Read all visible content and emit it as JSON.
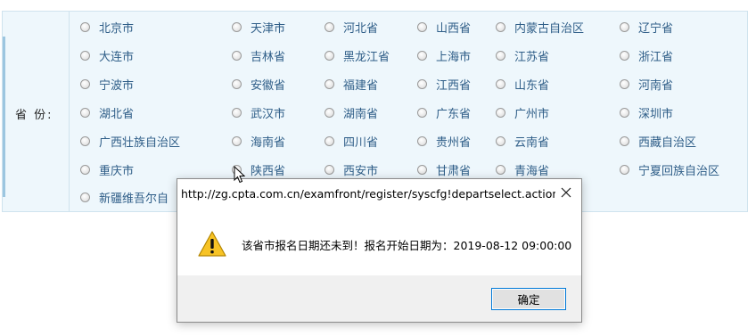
{
  "form": {
    "province_label": "省  份:",
    "options": [
      {
        "label": "北京市"
      },
      {
        "label": "天津市"
      },
      {
        "label": "河北省"
      },
      {
        "label": "山西省"
      },
      {
        "label": "内蒙古自治区"
      },
      {
        "label": "辽宁省"
      },
      {
        "label": "大连市"
      },
      {
        "label": "吉林省"
      },
      {
        "label": "黑龙江省"
      },
      {
        "label": "上海市"
      },
      {
        "label": "江苏省"
      },
      {
        "label": "浙江省"
      },
      {
        "label": "宁波市"
      },
      {
        "label": "安徽省"
      },
      {
        "label": "福建省"
      },
      {
        "label": "江西省"
      },
      {
        "label": "山东省"
      },
      {
        "label": "河南省"
      },
      {
        "label": "湖北省"
      },
      {
        "label": "武汉市"
      },
      {
        "label": "湖南省"
      },
      {
        "label": "广东省"
      },
      {
        "label": "广州市"
      },
      {
        "label": "深圳市"
      },
      {
        "label": "广西壮族自治区"
      },
      {
        "label": "海南省"
      },
      {
        "label": "四川省"
      },
      {
        "label": "贵州省"
      },
      {
        "label": "云南省"
      },
      {
        "label": "西藏自治区"
      },
      {
        "label": "重庆市"
      },
      {
        "label": "陕西省"
      },
      {
        "label": "西安市"
      },
      {
        "label": "甘肃省"
      },
      {
        "label": "青海省"
      },
      {
        "label": "宁夏回族自治区"
      },
      {
        "label": "新疆维吾尔自"
      }
    ]
  },
  "dialog": {
    "title": "http://zg.cpta.com.cn/examfront/register/syscfg!departselect.action?m...",
    "message": "该省市报名日期还未到！报名开始日期为：2019-08-12 09:00:00",
    "ok_label": "确定",
    "icon": "warning-icon"
  },
  "colors": {
    "panel_bg": "#eef7fc",
    "panel_border": "#cfe3ee",
    "option_text": "#2f5e88",
    "button_border": "#0078d7"
  }
}
